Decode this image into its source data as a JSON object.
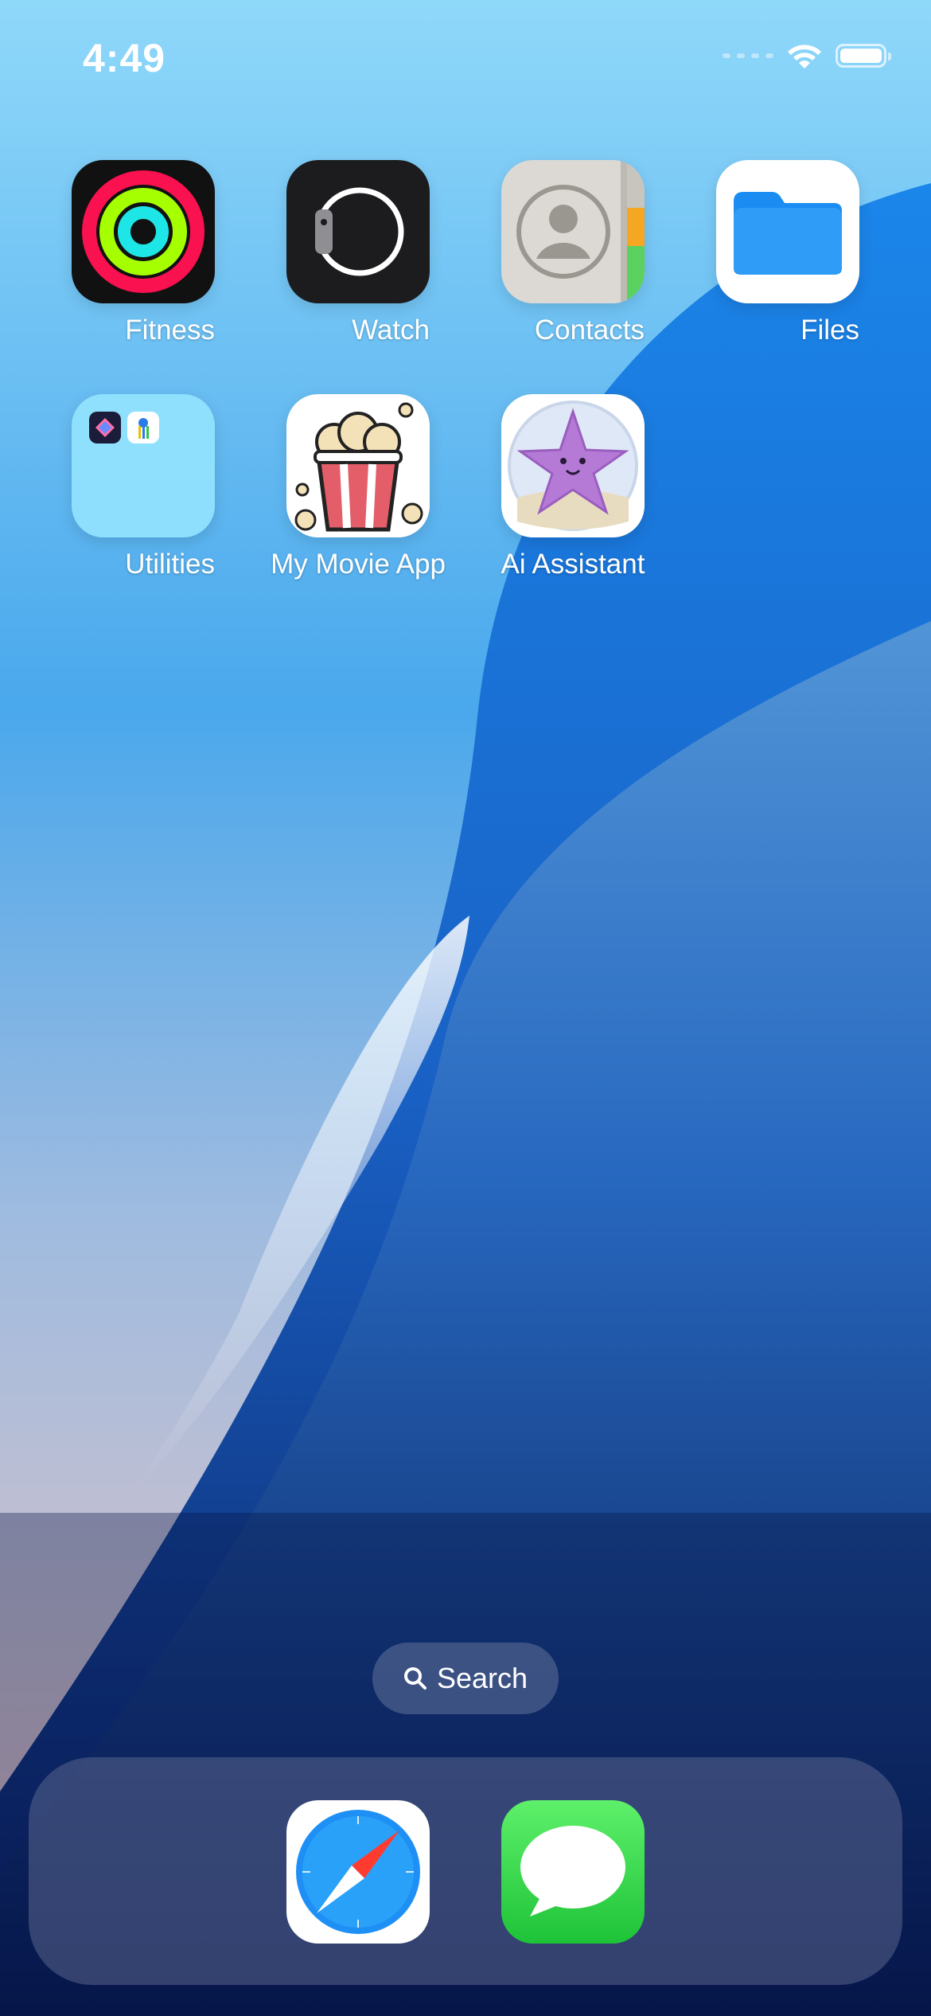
{
  "status_bar": {
    "time": "4:49",
    "icons": [
      "cellular-signal-icon",
      "wifi-icon",
      "battery-icon"
    ]
  },
  "home_apps": [
    {
      "label": "Fitness",
      "icon": "fitness-rings-icon"
    },
    {
      "label": "Watch",
      "icon": "watch-icon"
    },
    {
      "label": "Contacts",
      "icon": "contacts-icon"
    },
    {
      "label": "Files",
      "icon": "folder-icon"
    },
    {
      "label": "Utilities",
      "icon": "folder-utilities-icon"
    },
    {
      "label": "My Movie App",
      "icon": "popcorn-icon"
    },
    {
      "label": "Ai Assistant",
      "icon": "starfish-icon"
    }
  ],
  "search": {
    "label": "Search",
    "icon": "search-icon"
  },
  "dock": [
    {
      "name": "Safari",
      "icon": "compass-icon"
    },
    {
      "name": "Messages",
      "icon": "speech-bubble-icon"
    }
  ],
  "colors": {
    "wallpaper_top": "#8fd6f8",
    "wallpaper_mid": "#2b8fe6",
    "wallpaper_bottom": "#0a1d5c",
    "accent_pink": "#f4c7bf"
  }
}
